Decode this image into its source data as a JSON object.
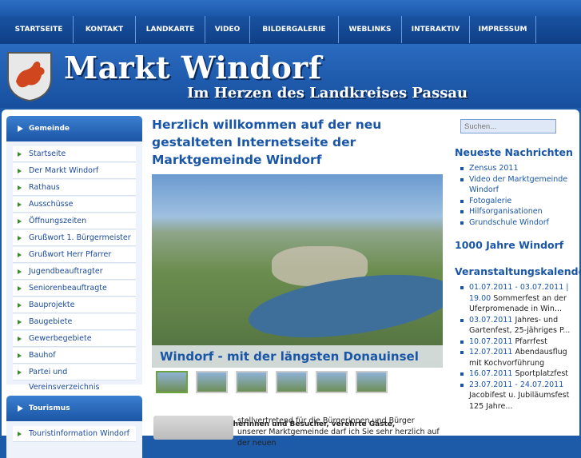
{
  "nav": [
    "STARTSEITE",
    "KONTAKT",
    "LANDKARTE",
    "VIDEO",
    "BILDERGALERIE",
    "WEBLINKS",
    "INTERAKTIV",
    "IMPRESSUM"
  ],
  "header": {
    "title": "Markt Windorf",
    "subtitle": "Im Herzen des Landkreises Passau"
  },
  "sidebar": {
    "gemeinde_title": "Gemeinde",
    "items": [
      "Startseite",
      "Der Markt Windorf",
      "Rathaus",
      "Ausschüsse",
      "Öffnungszeiten",
      "Grußwort 1. Bürgermeister",
      "Grußwort Herr Pfarrer",
      "Jugendbeauftragter",
      "Seniorenbeauftragte",
      "Bauprojekte",
      "Baugebiete",
      "Gewerbegebiete",
      "Bauhof",
      "Partei und Vereinsverzeichnis"
    ],
    "tourismus_title": "Tourismus",
    "tourismus_items": [
      "Touristinformation Windorf"
    ]
  },
  "main": {
    "headline": "Herzlich willkommen auf der neu gestalteten Internetseite der Marktgemeinde Windorf",
    "caption": "Windorf - mit der längsten Donauinsel",
    "greeting": "Sehr geehrte Besucherinnen und Besucher, verehrte Gäste,",
    "text": "stellvertretend für die Bürgerinnen und Bürger unserer Marktgemeinde darf ich Sie sehr herzlich auf der neuen"
  },
  "right": {
    "search_placeholder": "Suchen...",
    "news_title": "Neueste Nachrichten",
    "news": [
      "Zensus 2011",
      "Video der Marktgemeinde Windorf",
      "Fotogalerie",
      "Hilfsorganisationen",
      "Grundschule Windorf"
    ],
    "jubilee_title": "1000 Jahre Windorf",
    "events_title": "Veranstaltungskalender",
    "events": [
      {
        "date": "01.07.2011 - 03.07.2011 | 19.00",
        "text": "Sommerfest an der Uferpromenade in Win..."
      },
      {
        "date": "03.07.2011",
        "text": "Jahres- und Gartenfest, 25-jähriges P..."
      },
      {
        "date": "10.07.2011",
        "text": "Pfarrfest"
      },
      {
        "date": "12.07.2011",
        "text": "Abendausflug mit Kochvorführung"
      },
      {
        "date": "16.07.2011",
        "text": "Sportplatzfest"
      },
      {
        "date": "23.07.2011 - 24.07.2011",
        "text": "Jacobifest u. Jubiläumsfest 125 Jahre..."
      }
    ]
  }
}
